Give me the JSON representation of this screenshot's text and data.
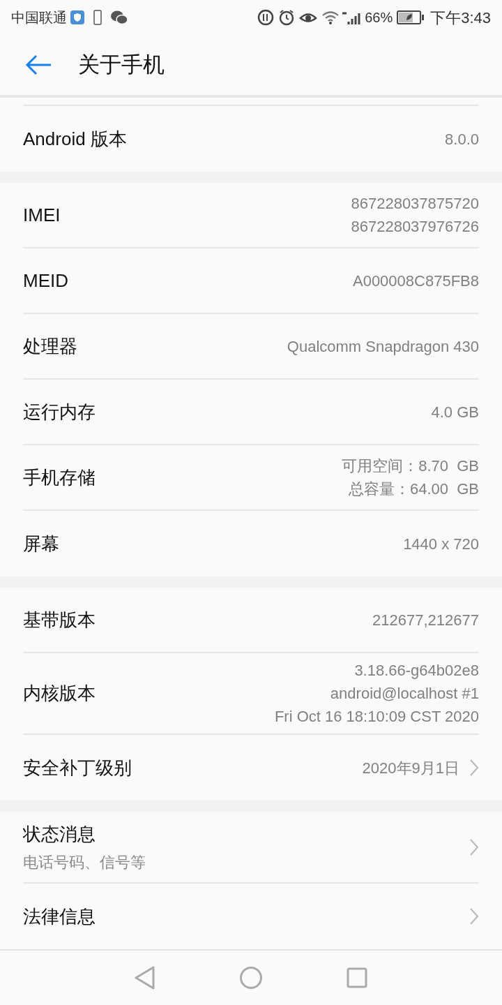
{
  "status_bar": {
    "carrier": "中国联通",
    "battery": "66%",
    "time": "下午3:43"
  },
  "title": "关于手机",
  "sections": [
    {
      "rows": [
        {
          "label": "Android 版本",
          "values": [
            "8.0.0"
          ],
          "chevron": false
        }
      ]
    },
    {
      "rows": [
        {
          "label": "IMEI",
          "values": [
            "867228037875720",
            "867228037976726"
          ],
          "chevron": false
        },
        {
          "label": "MEID",
          "values": [
            "A000008C875FB8"
          ],
          "chevron": false
        },
        {
          "label": "处理器",
          "values": [
            "Qualcomm Snapdragon 430"
          ],
          "chevron": false
        },
        {
          "label": "运行内存",
          "values": [
            "4.0 GB"
          ],
          "chevron": false
        },
        {
          "label": "手机存储",
          "values": [
            "可用空间：8.70  GB",
            "总容量：64.00  GB"
          ],
          "chevron": false
        },
        {
          "label": "屏幕",
          "values": [
            "1440 x 720"
          ],
          "chevron": false
        }
      ]
    },
    {
      "rows": [
        {
          "label": "基带版本",
          "values": [
            "212677,212677"
          ],
          "chevron": false
        },
        {
          "label": "内核版本",
          "values": [
            "3.18.66-g64b02e8",
            "android@localhost #1",
            "Fri Oct 16 18:10:09 CST 2020"
          ],
          "chevron": false
        },
        {
          "label": "安全补丁级别",
          "values": [
            "2020年9月1日"
          ],
          "chevron": true
        }
      ]
    },
    {
      "rows": [
        {
          "label": "状态消息",
          "subtitle": "电话号码、信号等",
          "chevron": true
        },
        {
          "label": "法律信息",
          "chevron": true
        }
      ]
    }
  ]
}
